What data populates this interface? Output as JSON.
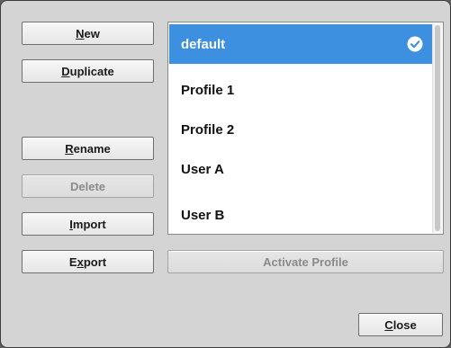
{
  "buttons": {
    "new": {
      "prefix": "",
      "mnemonic": "N",
      "rest": "ew"
    },
    "duplicate": {
      "prefix": "",
      "mnemonic": "D",
      "rest": "uplicate"
    },
    "rename": {
      "prefix": "",
      "mnemonic": "R",
      "rest": "ename"
    },
    "delete": {
      "label": "Delete"
    },
    "import": {
      "prefix": "",
      "mnemonic": "I",
      "rest": "mport"
    },
    "export": {
      "prefix": "E",
      "mnemonic": "x",
      "rest": "port"
    },
    "activate": {
      "label": "Activate Profile"
    },
    "close": {
      "prefix": "",
      "mnemonic": "C",
      "rest": "lose"
    }
  },
  "profiles": {
    "items": [
      {
        "label": "default",
        "selected": true,
        "active": true
      },
      {
        "label": "Profile 1",
        "selected": false
      },
      {
        "label": "Profile 2",
        "selected": false
      },
      {
        "label": "User A",
        "selected": false
      },
      {
        "label": "User B",
        "selected": false
      }
    ],
    "active_icon": "check-circle-icon"
  },
  "colors": {
    "selection": "#3d8fe0",
    "dialog_bg": "#d4d4d4",
    "disabled_text": "#8a8a8a"
  }
}
